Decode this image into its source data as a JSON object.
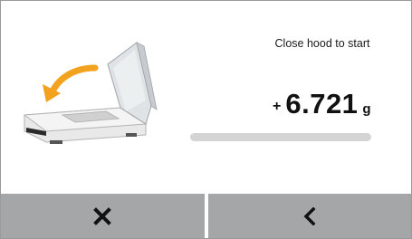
{
  "screen": {
    "status_message": "Close hood to start"
  },
  "weight": {
    "sign": "+",
    "value": "6.721",
    "unit": "g"
  },
  "progress": {
    "fraction": 0.0
  },
  "buttons": {
    "cancel_icon": "close-icon",
    "back_icon": "chevron-left-icon"
  },
  "colors": {
    "accent_arrow": "#f2a21f",
    "button_bg": "#a5a6a8",
    "progress_track": "#d4d4d4"
  }
}
